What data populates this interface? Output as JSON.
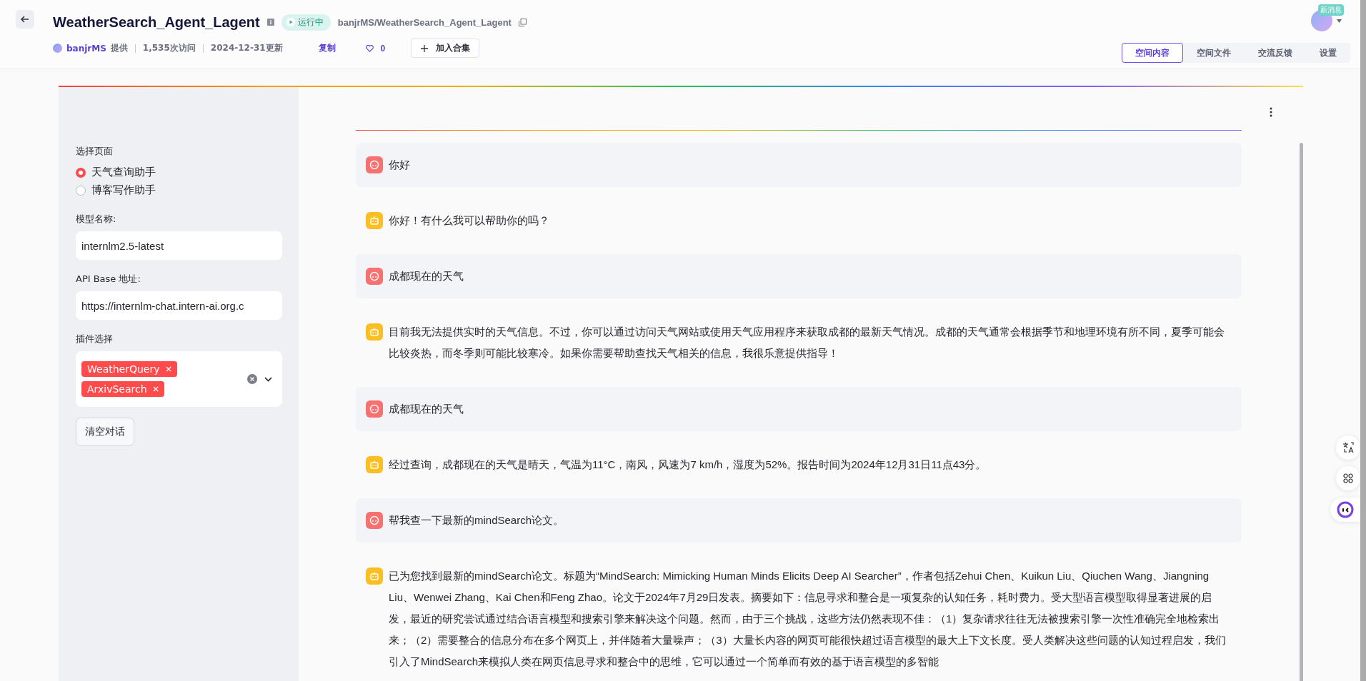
{
  "header": {
    "title": "WeatherSearch_Agent_Lagent",
    "status": "运行中",
    "repo": "banjrMS/WeatherSearch_Agent_Lagent",
    "author": "banjrMS",
    "provided": "提供",
    "visits": "1,535次访问",
    "updated": "2024-12-31更新",
    "copy": "复制",
    "likes": "0",
    "add_collection": "加入合集",
    "badge": "新消息"
  },
  "tabs": [
    {
      "label": "空间内容",
      "selected": true
    },
    {
      "label": "空间文件",
      "selected": false
    },
    {
      "label": "交流反馈",
      "selected": false
    },
    {
      "label": "设置",
      "selected": false
    }
  ],
  "sidebar": {
    "page_label": "选择页面",
    "pages": [
      {
        "label": "天气查询助手",
        "selected": true
      },
      {
        "label": "博客写作助手",
        "selected": false
      }
    ],
    "model_label": "模型名称:",
    "model_value": "internlm2.5-latest",
    "api_label": "API Base 地址:",
    "api_value": "https://internlm-chat.intern-ai.org.c",
    "plugin_label": "插件选择",
    "plugins": [
      "WeatherQuery",
      "ArxivSearch"
    ],
    "clear_button": "清空对话"
  },
  "messages": [
    {
      "kind": "user",
      "text": "你好"
    },
    {
      "kind": "bot",
      "text": "你好！有什么我可以帮助你的吗？"
    },
    {
      "kind": "user",
      "text": "成都现在的天气"
    },
    {
      "kind": "bot",
      "text": "目前我无法提供实时的天气信息。不过，你可以通过访问天气网站或使用天气应用程序来获取成都的最新天气情况。成都的天气通常会根据季节和地理环境有所不同，夏季可能会比较炎热，而冬季则可能比较寒冷。如果你需要帮助查找天气相关的信息，我很乐意提供指导！"
    },
    {
      "kind": "user",
      "text": "成都现在的天气"
    },
    {
      "kind": "bot",
      "text": "经过查询，成都现在的天气是晴天，气温为11°C，南风，风速为7 km/h，湿度为52%。报告时间为2024年12月31日11点43分。"
    },
    {
      "kind": "user",
      "text": "帮我查一下最新的mindSearch论文。"
    },
    {
      "kind": "bot",
      "text": "已为您找到最新的mindSearch论文。标题为“MindSearch: Mimicking Human Minds Elicits Deep AI Searcher”，作者包括Zehui Chen、Kuikun Liu、Qiuchen Wang、Jiangning Liu、Wenwei Zhang、Kai Chen和Feng Zhao。论文于2024年7月29日发表。摘要如下：信息寻求和整合是一项复杂的认知任务，耗时费力。受大型语言模型取得显著进展的启发，最近的研究尝试通过结合语言模型和搜索引擎来解决这个问题。然而，由于三个挑战，这些方法仍然表现不佳：（1）复杂请求往往无法被搜索引擎一次性准确完全地检索出来；（2）需要整合的信息分布在多个网页上，并伴随着大量噪声；（3）大量长内容的网页可能很快超过语言模型的最大上下文长度。受人类解决这些问题的认知过程启发，我们引入了MindSearch来模拟人类在网页信息寻求和整合中的思维，它可以通过一个简单而有效的基于语言模型的多智能"
    }
  ]
}
